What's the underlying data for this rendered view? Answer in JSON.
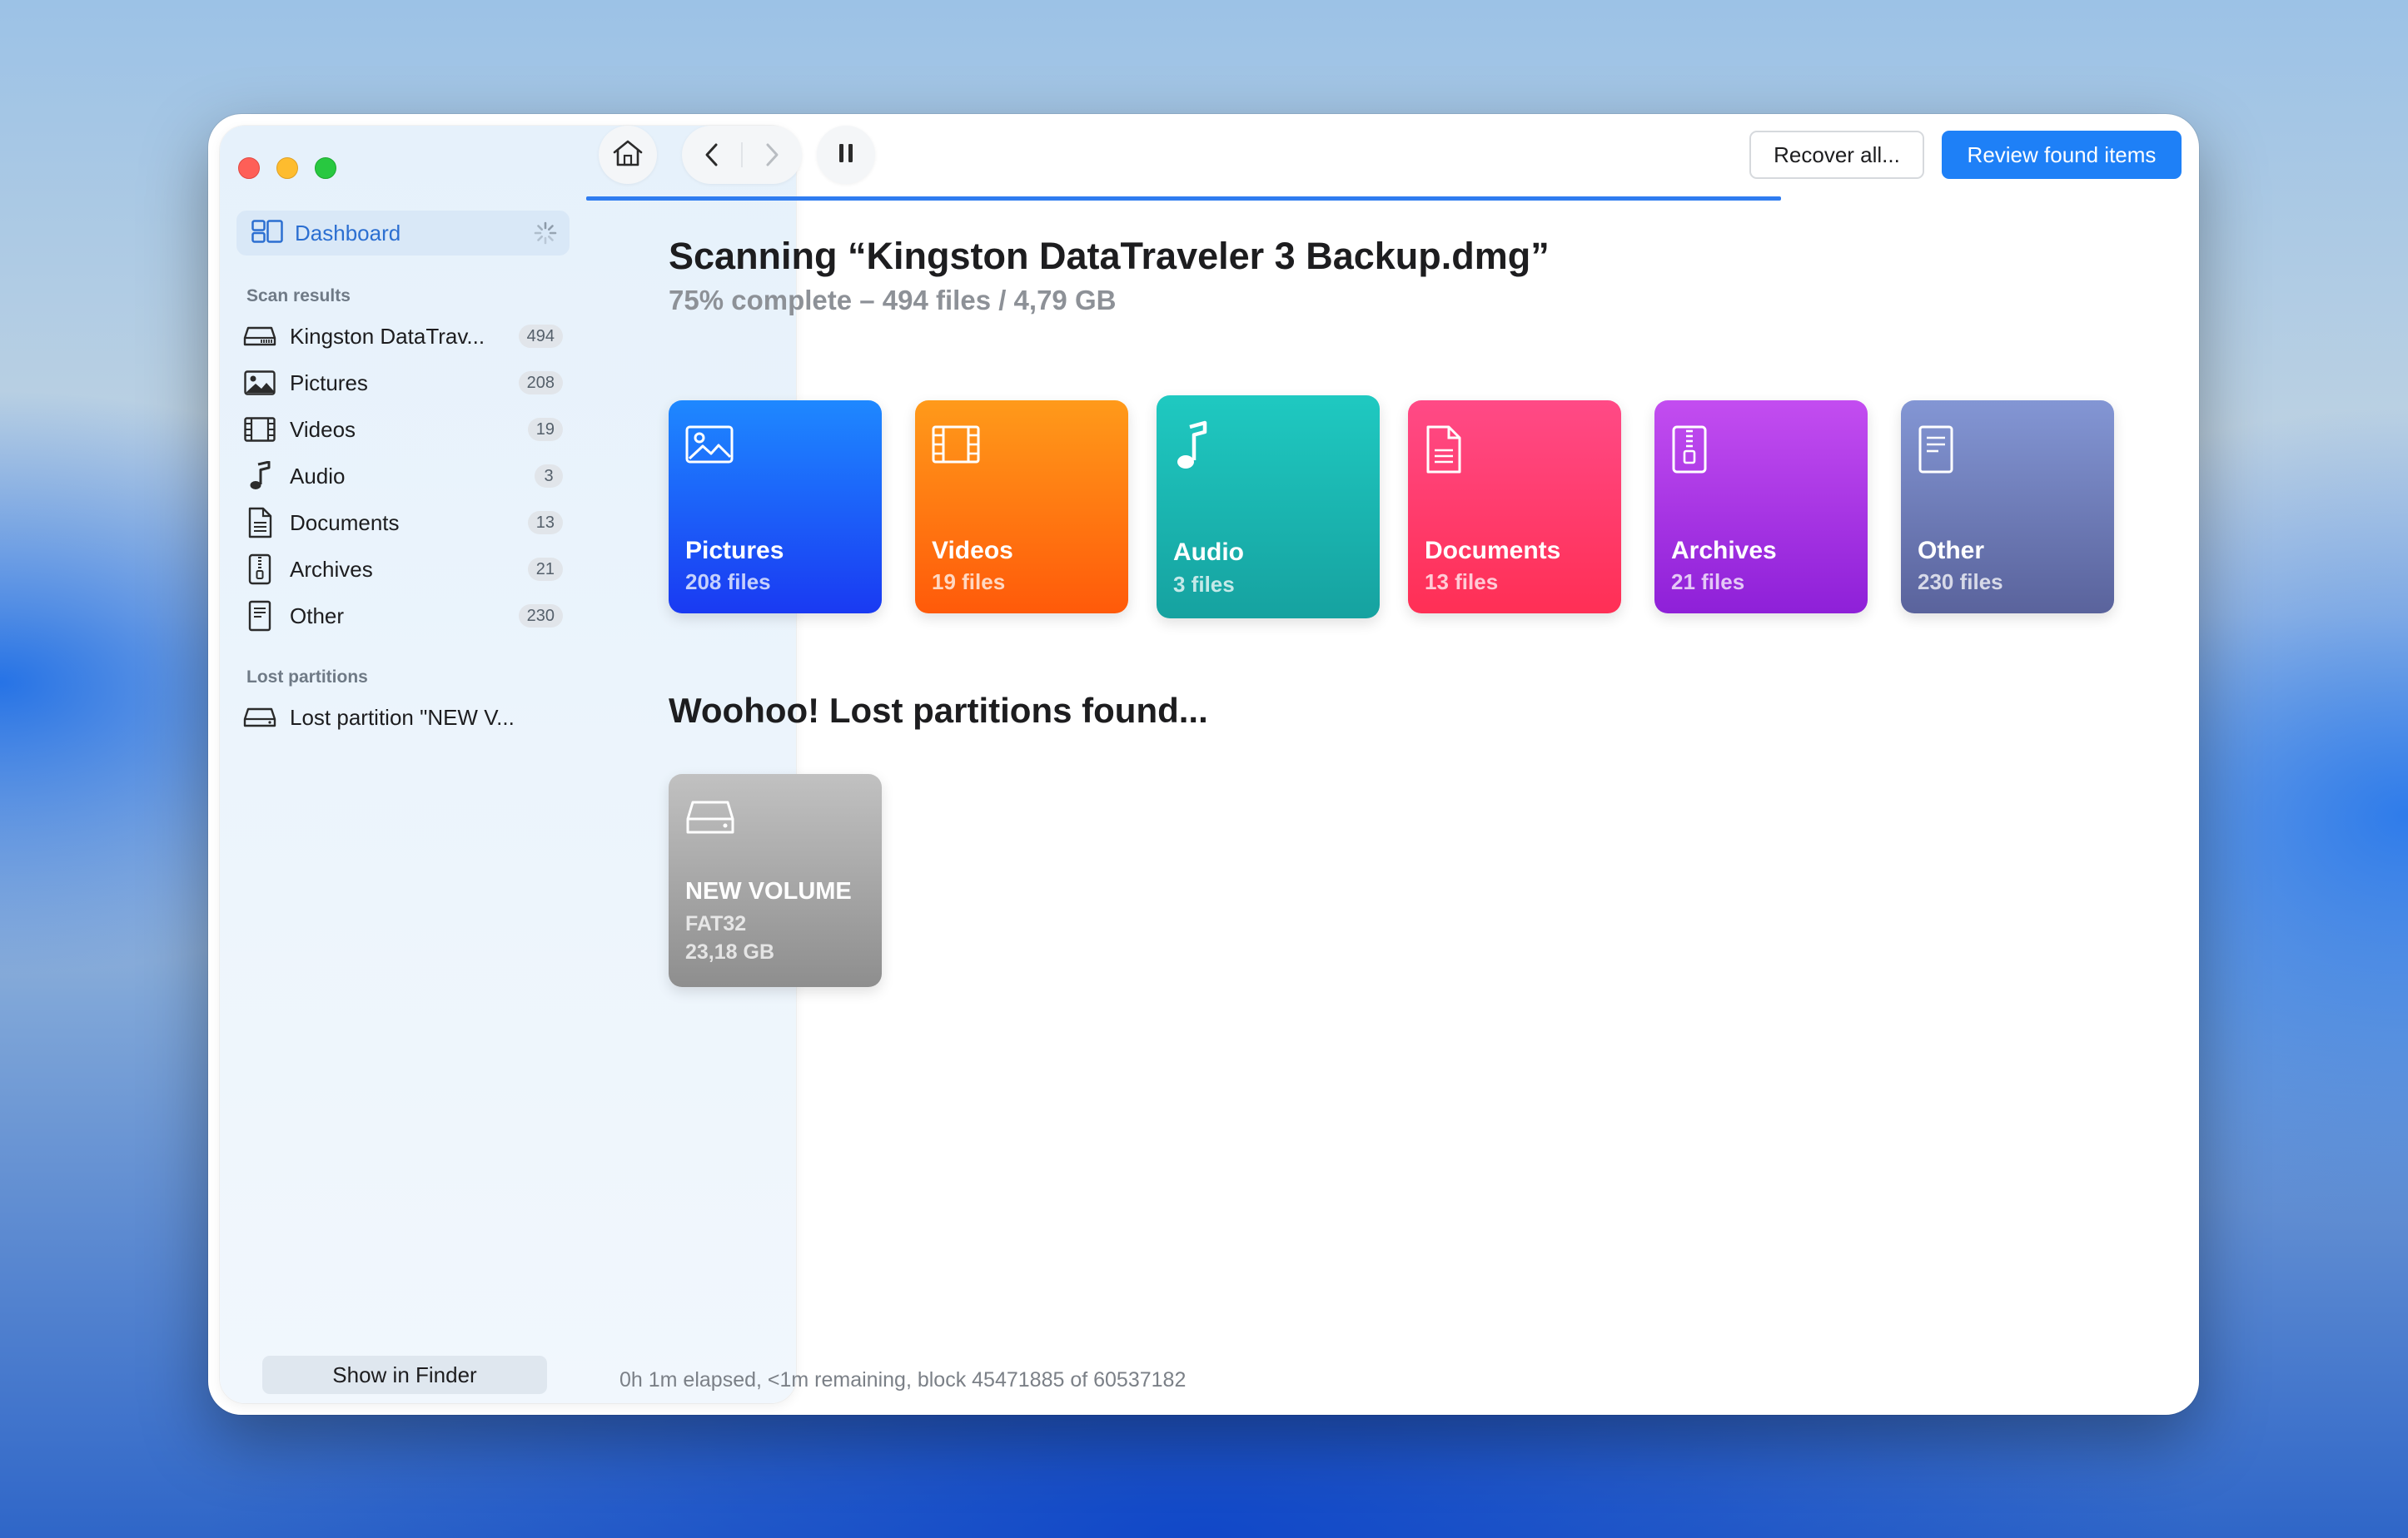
{
  "sidebar": {
    "dashboard_label": "Dashboard",
    "scan_results_title": "Scan results",
    "items": [
      {
        "label": "Kingston DataTrav...",
        "count": "494",
        "icon": "drive-icon"
      },
      {
        "label": "Pictures",
        "count": "208",
        "icon": "picture-icon"
      },
      {
        "label": "Videos",
        "count": "19",
        "icon": "film-icon"
      },
      {
        "label": "Audio",
        "count": "3",
        "icon": "music-note-icon"
      },
      {
        "label": "Documents",
        "count": "13",
        "icon": "document-icon"
      },
      {
        "label": "Archives",
        "count": "21",
        "icon": "archive-icon"
      },
      {
        "label": "Other",
        "count": "230",
        "icon": "other-file-icon"
      }
    ],
    "lost_partitions_title": "Lost partitions",
    "lost_partition_item": "Lost partition \"NEW V...",
    "show_in_finder": "Show in Finder"
  },
  "toolbar": {
    "recover_all": "Recover all...",
    "review_found_items": "Review found items"
  },
  "progress": {
    "fraction": 0.75
  },
  "main": {
    "title": "Scanning “Kingston DataTraveler 3 Backup.dmg”",
    "subtitle": "75% complete – 494 files / 4,79 GB",
    "tiles": [
      {
        "name": "Pictures",
        "count": "208 files"
      },
      {
        "name": "Videos",
        "count": "19 files"
      },
      {
        "name": "Audio",
        "count": "3 files"
      },
      {
        "name": "Documents",
        "count": "13 files"
      },
      {
        "name": "Archives",
        "count": "21 files"
      },
      {
        "name": "Other",
        "count": "230 files"
      }
    ],
    "lost_title": "Woohoo! Lost partitions found...",
    "volume": {
      "name": "NEW VOLUME",
      "fs": "FAT32",
      "size": "23,18 GB"
    }
  },
  "status": "0h 1m elapsed, <1m remaining, block 45471885 of 60537182",
  "colors": {
    "accent": "#1e80f7",
    "pictures": "#1a5ef8",
    "videos": "#ff7a12",
    "audio": "#18b6b0",
    "documents": "#ff3b6e",
    "archives": "#a936e4",
    "other": "#6e79b8",
    "volume": "#a8a8a8"
  }
}
